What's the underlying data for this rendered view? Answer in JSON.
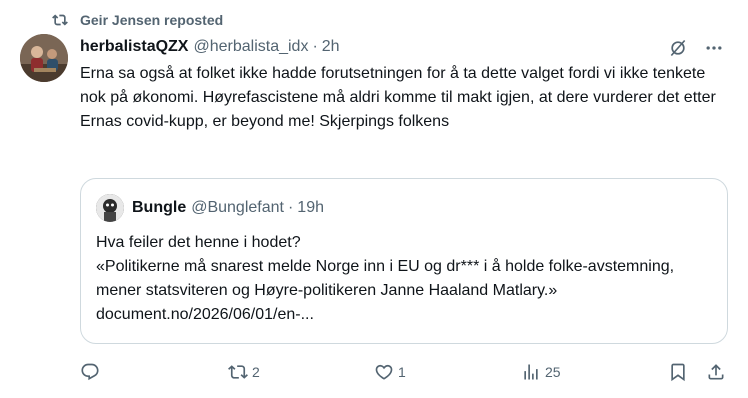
{
  "repost": {
    "label": "Geir Jensen reposted",
    "icon": "repost-icon"
  },
  "tweet": {
    "author_name": "herbalistaQZX",
    "author_handle": "@herbalista_idx",
    "separator": "·",
    "time": "2h",
    "text": "Erna sa også at folket ikke hadde forutsetningen for å ta dette valget fordi vi ikke tenkete nok på økonomi. Høyrefascistene må aldri komme til makt igjen, at dere vurderer det etter Ernas covid-kupp, er beyond me! Skjerpings folkens"
  },
  "quote": {
    "author_name": "Bungle",
    "author_handle": "@Bunglefant",
    "separator": "·",
    "time": "19h",
    "text": "Hva feiler det henne i hodet?\n«Politikerne må snarest melde Norge inn i EU og dr*** i å holde folke-avstemning, mener statsviteren og Høyre-politikeren Janne Haaland Matlary.» document.no/2026/06/01/en-..."
  },
  "actions": {
    "replies": "",
    "reposts": "2",
    "likes": "1",
    "views": "25"
  },
  "colors": {
    "text": "#0f1419",
    "secondary": "#536471",
    "border": "#cfd9de"
  }
}
